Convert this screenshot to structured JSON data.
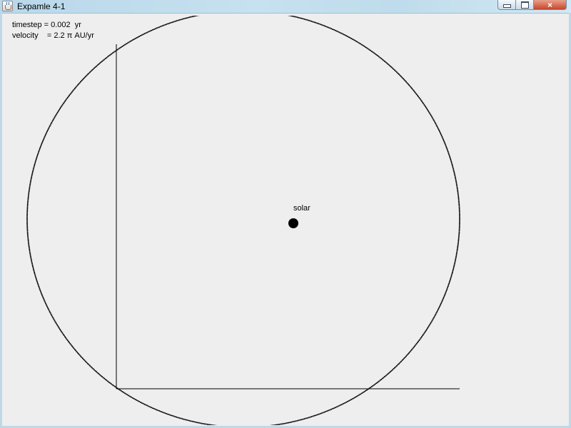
{
  "window": {
    "title": "Expamle 4-1",
    "controls": {
      "minimize": "minimize-icon",
      "maximize": "maximize-icon",
      "close": "×"
    }
  },
  "info": {
    "timestep_line": "timestep = 0.002  yr",
    "velocity_line": "velocity    = 2.2 π AU/yr"
  },
  "sun": {
    "label": "solar",
    "color": "#000000"
  },
  "colors": {
    "background": "#eeeeee",
    "orbit": "#000000",
    "axes": "#000000"
  }
}
